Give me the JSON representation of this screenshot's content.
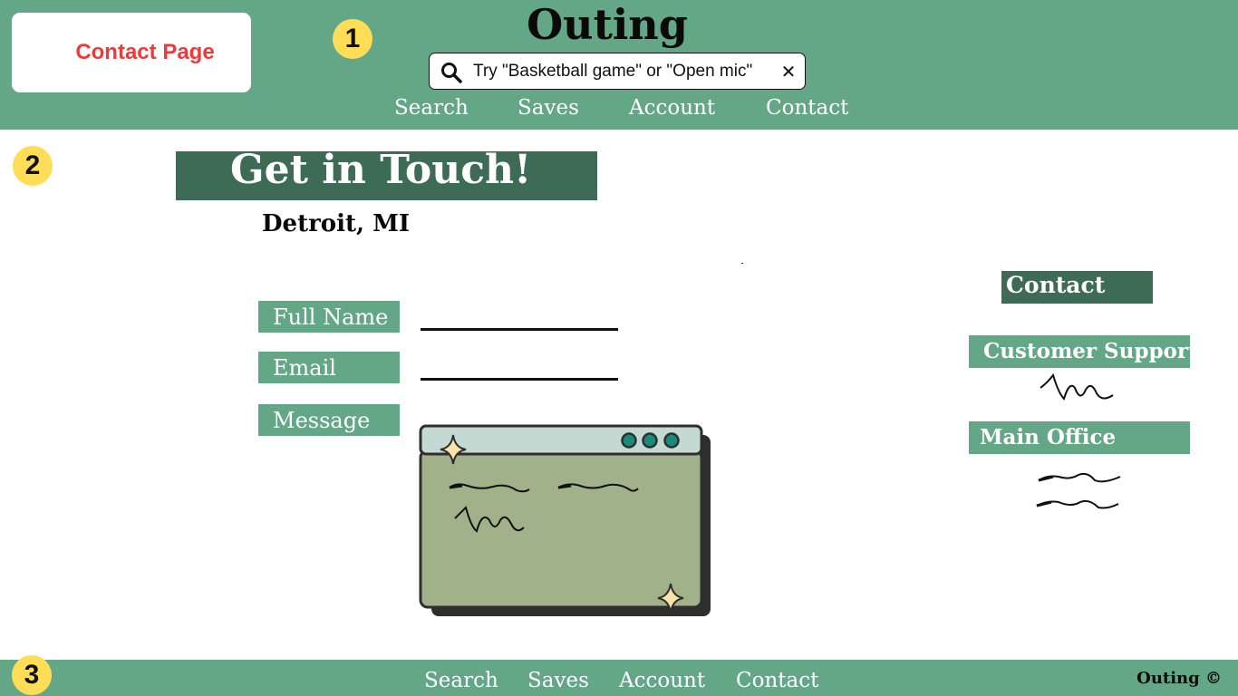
{
  "page_label": "Contact Page",
  "badges": [
    "1",
    "2",
    "3"
  ],
  "header": {
    "brand": "Outing",
    "search_placeholder": "Try \"Basketball game\" or \"Open mic\"",
    "nav": [
      "Search",
      "Saves",
      "Account",
      "Contact"
    ]
  },
  "main": {
    "title": "Get in Touch!",
    "location": "Detroit, MI",
    "form": {
      "full_name_label": "Full Name",
      "email_label": "Email",
      "message_label": "Message"
    },
    "contact": {
      "heading": "Contact",
      "customer_support_label": "Customer Support",
      "main_office_label": "Main Office"
    }
  },
  "footer": {
    "nav": [
      "Search",
      "Saves",
      "Account",
      "Contact"
    ],
    "copyright": "Outing ©"
  },
  "colors": {
    "header_green": "#63a787",
    "dark_green": "#3d6b55",
    "page_label_red": "#f03a3a",
    "badge_yellow": "#ffdd57"
  }
}
